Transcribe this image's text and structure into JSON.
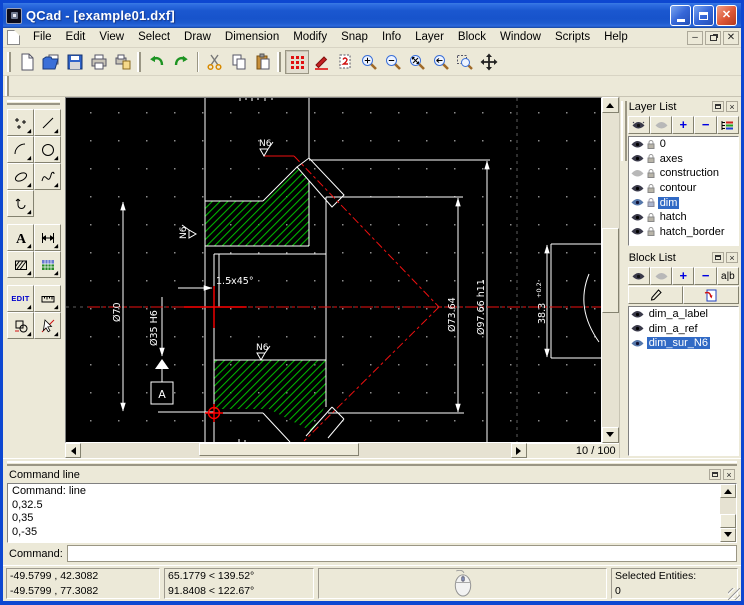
{
  "window": {
    "title": "QCad - [example01.dxf]"
  },
  "menu": {
    "items": [
      {
        "label": "File"
      },
      {
        "label": "Edit"
      },
      {
        "label": "View"
      },
      {
        "label": "Select"
      },
      {
        "label": "Draw"
      },
      {
        "label": "Dimension"
      },
      {
        "label": "Modify"
      },
      {
        "label": "Snap"
      },
      {
        "label": "Info"
      },
      {
        "label": "Layer"
      },
      {
        "label": "Block"
      },
      {
        "label": "Window"
      },
      {
        "label": "Scripts"
      },
      {
        "label": "Help"
      }
    ]
  },
  "toolbar": {
    "icons": [
      "new",
      "open",
      "save",
      "print",
      "print-preview",
      "undo",
      "redo",
      "cut",
      "copy",
      "paste",
      "grid-toggle",
      "draft-mode",
      "regenerate",
      "zoom-in",
      "zoom-out",
      "auto-zoom",
      "previous-view",
      "zoom-window",
      "pan"
    ]
  },
  "left_tools": {
    "tools": [
      "points",
      "lines",
      "arcs",
      "circles",
      "ellipses",
      "splines",
      "polylines",
      "text",
      "dimensions",
      "hatch",
      "insert-image",
      "edit",
      "measure",
      "blocks",
      "select"
    ],
    "text_tool_glyph": "A",
    "edit_label": "EDIT"
  },
  "canvas": {
    "labels": {
      "dim_70": "Ø70",
      "dim_35": "Ø35 H6",
      "chamfer": "1.5x45°",
      "dim_7364": "Ø73.64",
      "dim_9766": "Ø97.66 h11",
      "dim_383": "38.3",
      "dim_383_tol": "+0.2",
      "datum": "A",
      "n6": "N6"
    },
    "page_indicator": "10 / 100",
    "colors": {
      "background": "#000000",
      "geometry": "#ffffff",
      "hatch": "#00b400",
      "centerline": "#ee1010",
      "construction": "#5e5e5e"
    }
  },
  "layer_list": {
    "title": "Layer List",
    "layers": [
      {
        "name": "0",
        "visible": true
      },
      {
        "name": "axes",
        "visible": true
      },
      {
        "name": "construction",
        "visible": false
      },
      {
        "name": "contour",
        "visible": true
      },
      {
        "name": "dim",
        "visible": true,
        "selected": true
      },
      {
        "name": "hatch",
        "visible": true
      },
      {
        "name": "hatch_border",
        "visible": true
      }
    ]
  },
  "block_list": {
    "title": "Block List",
    "rename_label": "a|b",
    "blocks": [
      {
        "name": "dim_a_label"
      },
      {
        "name": "dim_a_ref"
      },
      {
        "name": "dim_sur_N6",
        "selected": true
      }
    ]
  },
  "command_panel": {
    "title": "Command line",
    "history": [
      "Command: line",
      "0,32.5",
      "0,35",
      "0,-35"
    ],
    "prompt": "Command:",
    "input_value": ""
  },
  "status_bar": {
    "abs_coord": "-49.5799 , 42.3082",
    "rel_coord": "-49.5799 , 77.3082",
    "abs_polar": "65.1779 < 139.52°",
    "rel_polar": "91.8408 < 122.67°",
    "selected_label": "Selected Entities:",
    "selected_count": "0"
  },
  "colors": {
    "selection": "#316AC5",
    "titlebar": "#1b58d0",
    "frame": "#0d47d1",
    "face": "#ECE9D8"
  }
}
